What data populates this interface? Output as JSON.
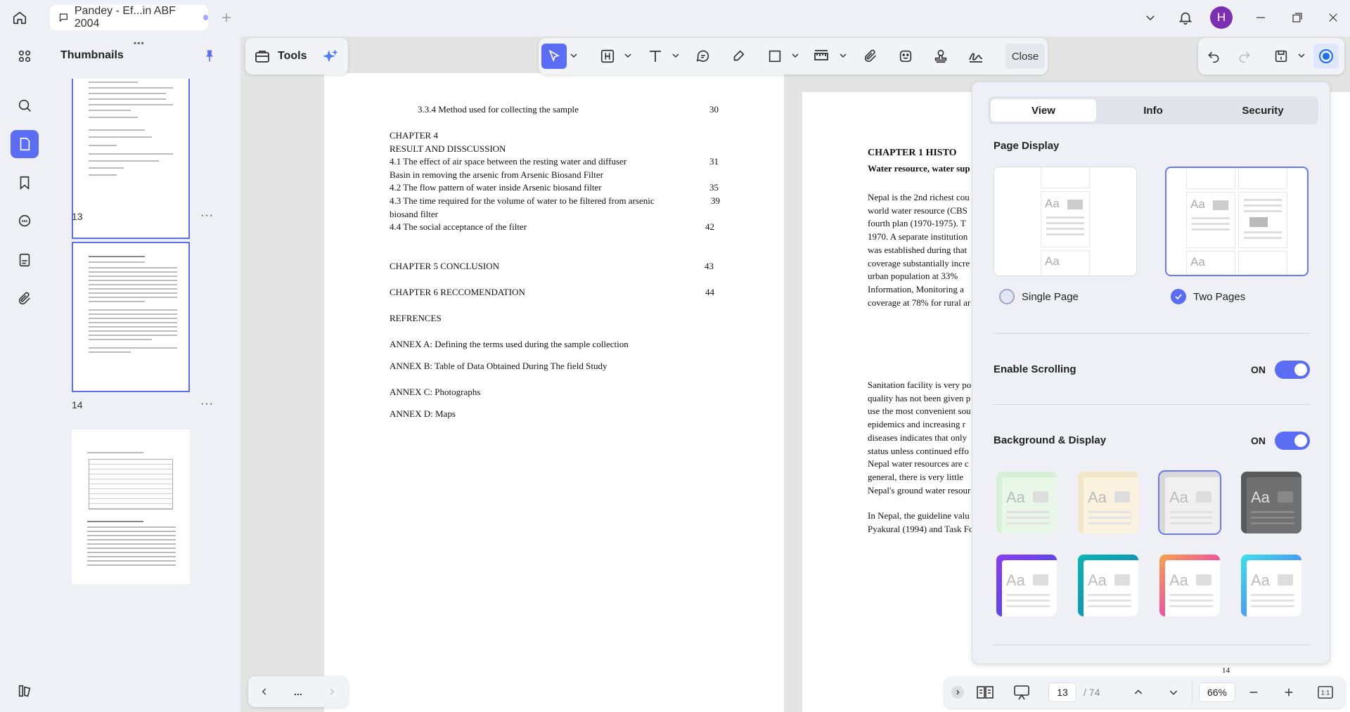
{
  "titlebar": {
    "tab_title": "Pandey - Ef...in ABF 2004",
    "avatar_initial": "H"
  },
  "thumbnails": {
    "title": "Thumbnails",
    "items": [
      {
        "page": "13"
      },
      {
        "page": "14"
      }
    ]
  },
  "toolbar": {
    "tools_label": "Tools",
    "close_label": "Close"
  },
  "page13": {
    "lines": [
      {
        "text": "3.3.4    Method used for collecting the sample",
        "num": "30"
      },
      {
        "text": "CHAPTER 4",
        "num": ""
      },
      {
        "text": "RESULT AND DISSCUSSION",
        "num": ""
      },
      {
        "text": "4.1   The effect of air space between the resting water and diffuser",
        "num": "31"
      },
      {
        "text": "Basin in removing the arsenic from Arsenic Biosand Filter",
        "num": ""
      },
      {
        "text": "4.2 The flow pattern of water inside Arsenic biosand filter",
        "num": "35"
      },
      {
        "text": " 4.3   The time required for the volume of water to be filtered from arsenic",
        "num": "39"
      },
      {
        "text": " biosand filter",
        "num": ""
      },
      {
        "text": "4.4  The  social acceptance of the filter",
        "num": "42"
      },
      {
        "text": "CHAPTER 5  CONCLUSION",
        "num": "43"
      },
      {
        "text": "CHAPTER 6   RECCOMENDATION",
        "num": "44"
      },
      {
        "text": "REFRENCES",
        "num": ""
      },
      {
        "text": "ANNEX   A: Defining the terms used during the sample collection",
        "num": ""
      },
      {
        "text": "ANNEX B:   Table of Data Obtained During The field Study",
        "num": ""
      },
      {
        "text": "ANNEX C:   Photographs",
        "num": ""
      },
      {
        "text": "ANNEX D: Maps",
        "num": ""
      }
    ]
  },
  "page14": {
    "heading": "CHAPTER 1   HISTO",
    "subheading": "Water resource, water sup",
    "para1": [
      "Nepal is the 2nd richest cou",
      "world water resource (CBS",
      "fourth plan (1970-1975). T",
      "1970. A separate institution",
      "was established during that",
      "coverage substantially incre",
      "urban population at 33%",
      "Information, Monitoring  a",
      "coverage at 78% for rural ar"
    ],
    "para2": [
      "Sanitation facility is very po",
      "quality has not been given p",
      "use the most convenient sou",
      "epidemics and increasing r",
      "diseases indicates that only",
      "status unless continued effo",
      "Nepal water resources are c",
      "general, there is very little",
      "Nepal's ground water resour"
    ],
    "para3": [
      "In Nepal, the guideline valu",
      "Pyakural (1994) and Task Fo"
    ],
    "page_number": "14"
  },
  "side_panel": {
    "tabs": [
      "View",
      "Info",
      "Security"
    ],
    "active_tab": "View",
    "page_display_title": "Page Display",
    "single_page_label": "Single Page",
    "two_pages_label": "Two Pages",
    "selected_layout": "Two Pages",
    "enable_scrolling_label": "Enable Scrolling",
    "enable_scrolling_state": "ON",
    "background_label": "Background & Display",
    "background_state": "ON",
    "card_text": "Aa",
    "themes": [
      {
        "name": "green",
        "bg": "#d6f0d6",
        "fg": "#e9f7e9"
      },
      {
        "name": "beige",
        "bg": "#f3e6c8",
        "fg": "#faf2de"
      },
      {
        "name": "gray",
        "bg": "#d9d9d9",
        "fg": "#f0f0f0",
        "selected": true
      },
      {
        "name": "dark",
        "bg": "#5a5a5a",
        "fg": "#707070"
      },
      {
        "name": "purple",
        "bg": "#6a3de8",
        "fg": "#ffffff"
      },
      {
        "name": "teal",
        "bg": "#10a7a7",
        "fg": "#ffffff"
      },
      {
        "name": "sunset",
        "bg": "#f06a8a",
        "fg": "#ffffff"
      },
      {
        "name": "sky",
        "bg": "#4cc9f0",
        "fg": "#ffffff"
      }
    ]
  },
  "status_bar": {
    "current_page": "13",
    "total_pages": "/ 74",
    "zoom": "66%",
    "nav_more": "..."
  },
  "colors": {
    "accent": "#5b6cf5",
    "background": "#eef0f5"
  }
}
